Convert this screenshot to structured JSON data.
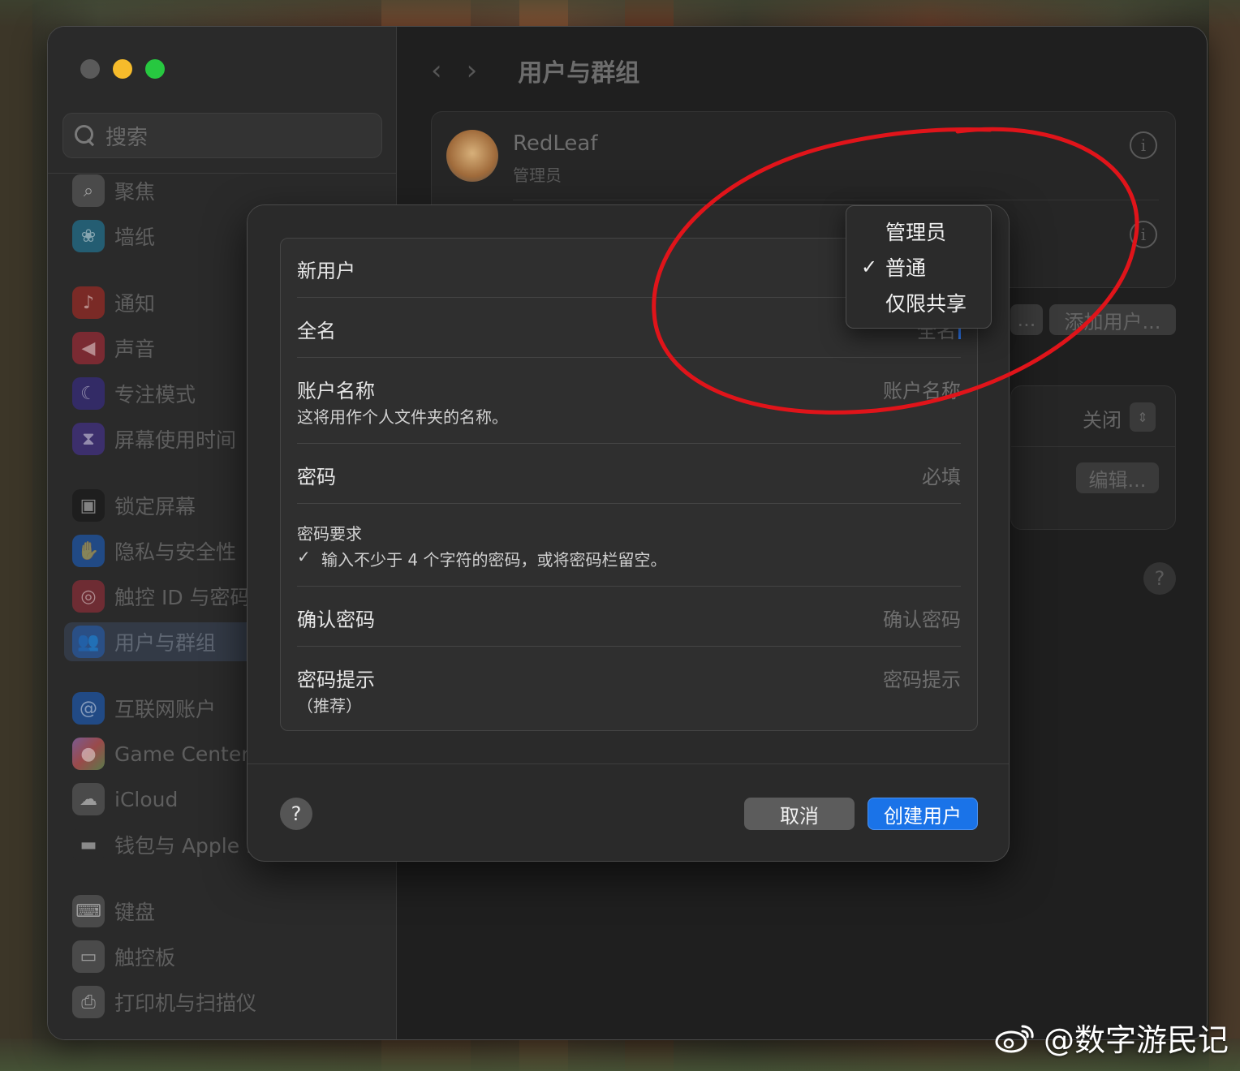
{
  "window": {
    "title": "用户与群组"
  },
  "search": {
    "placeholder": "搜索"
  },
  "sidebar": {
    "items": [
      {
        "label": "聚焦",
        "icon": "magnifier-icon",
        "color": "#6b6b6b"
      },
      {
        "label": "墙纸",
        "icon": "flower-icon",
        "color": "#2e8fb0"
      },
      {
        "label": "通知",
        "icon": "bell-icon",
        "color": "#c23a33"
      },
      {
        "label": "声音",
        "icon": "speaker-icon",
        "color": "#c23a48"
      },
      {
        "label": "专注模式",
        "icon": "moon-icon",
        "color": "#4a3d9a"
      },
      {
        "label": "屏幕使用时间",
        "icon": "hourglass-icon",
        "color": "#5b45a3"
      },
      {
        "label": "锁定屏幕",
        "icon": "lock-icon",
        "color": "#1c1c1c"
      },
      {
        "label": "隐私与安全性",
        "icon": "hand-icon",
        "color": "#2c6bc9"
      },
      {
        "label": "触控 ID 与密码",
        "icon": "fingerprint-icon",
        "color": "#c8404a"
      },
      {
        "label": "用户与群组",
        "icon": "users-icon",
        "color": "#2c6bc9"
      },
      {
        "label": "互联网账户",
        "icon": "at-icon",
        "color": "#2c6bc9"
      },
      {
        "label": "Game Center",
        "icon": "game-center-icon",
        "color": "#a66fb2"
      },
      {
        "label": "iCloud",
        "icon": "cloud-icon",
        "color": "#3b8fd6"
      },
      {
        "label": "钱包与 Apple P",
        "icon": "wallet-icon",
        "color": "#3a3a3a"
      },
      {
        "label": "键盘",
        "icon": "keyboard-icon",
        "color": "#6b6b6b"
      },
      {
        "label": "触控板",
        "icon": "trackpad-icon",
        "color": "#6b6b6b"
      },
      {
        "label": "打印机与扫描仪",
        "icon": "printer-icon",
        "color": "#6b6b6b"
      }
    ]
  },
  "user_card": {
    "name": "RedLeaf",
    "role": "管理员"
  },
  "background_buttons": {
    "partial": "...",
    "add_user": "添加用户...",
    "auto_login_value": "关闭",
    "edit": "编辑...",
    "help": "?"
  },
  "dialog": {
    "new_user_label": "新用户",
    "full_name_label": "全名",
    "full_name_placeholder": "全名",
    "account_name_label": "账户名称",
    "account_name_hint": "这将用作个人文件夹的名称。",
    "account_name_placeholder": "账户名称",
    "password_label": "密码",
    "password_placeholder": "必填",
    "password_req_title": "密码要求",
    "password_req_item": "输入不少于 4 个字符的密码，或将密码栏留空。",
    "password_req_check": "✓",
    "confirm_label": "确认密码",
    "confirm_placeholder": "确认密码",
    "hint_label": "密码提示",
    "hint_sublabel": "（推荐）",
    "hint_placeholder": "密码提示",
    "help": "?",
    "cancel": "取消",
    "create": "创建用户"
  },
  "popup_menu": {
    "items": [
      {
        "label": "管理员",
        "checked": false
      },
      {
        "label": "普通",
        "checked": true
      },
      {
        "label": "仅限共享",
        "checked": false
      }
    ],
    "check_mark": "✓"
  },
  "annotation": {
    "color": "#e0141a"
  },
  "watermark": {
    "text": "@数字游民记"
  }
}
